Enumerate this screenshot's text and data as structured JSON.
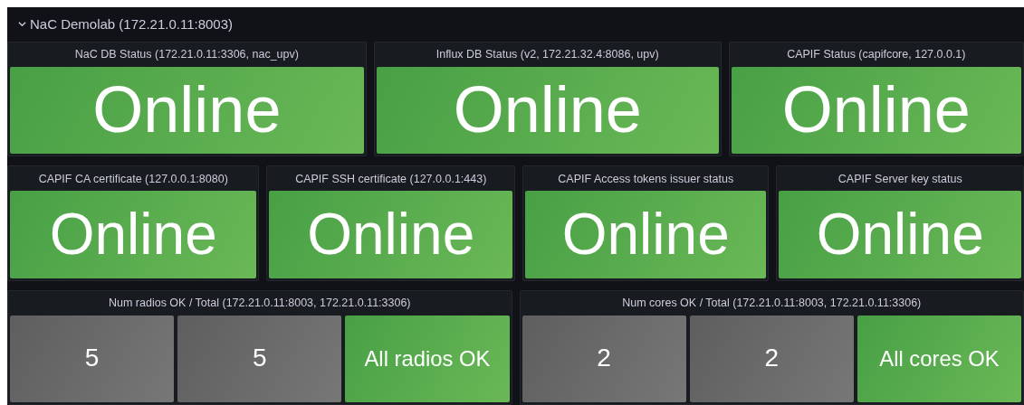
{
  "row": {
    "title": "NaC Demolab (172.21.0.11:8003)",
    "expanded": true
  },
  "panel_rows": [
    {
      "panels": [
        {
          "title": "NaC DB Status (172.21.0.11:3306, nac_upv)",
          "tiles": [
            {
              "value": "Online",
              "kind": "ok"
            }
          ]
        },
        {
          "title": "Influx DB Status (v2, 172.21.32.4:8086, upv)",
          "tiles": [
            {
              "value": "Online",
              "kind": "ok"
            }
          ]
        },
        {
          "title": "CAPIF Status (capifcore, 127.0.0.1)",
          "tiles": [
            {
              "value": "Online",
              "kind": "ok"
            }
          ]
        }
      ]
    },
    {
      "panels": [
        {
          "title": "CAPIF CA certificate (127.0.0.1:8080)",
          "tiles": [
            {
              "value": "Online",
              "kind": "ok"
            }
          ]
        },
        {
          "title": "CAPIF SSH certificate (127.0.0.1:443)",
          "tiles": [
            {
              "value": "Online",
              "kind": "ok"
            }
          ]
        },
        {
          "title": "CAPIF Access tokens issuer status",
          "tiles": [
            {
              "value": "Online",
              "kind": "ok"
            }
          ]
        },
        {
          "title": "CAPIF Server key status",
          "tiles": [
            {
              "value": "Online",
              "kind": "ok"
            }
          ]
        }
      ]
    },
    {
      "panels": [
        {
          "title": "Num radios OK / Total (172.21.0.11:8003, 172.21.0.11:3306)",
          "tiles": [
            {
              "value": "5",
              "kind": "neutral"
            },
            {
              "value": "5",
              "kind": "neutral"
            },
            {
              "value": "All radios OK",
              "kind": "ok"
            }
          ]
        },
        {
          "title": "Num cores OK / Total (172.21.0.11:8003, 172.21.0.11:3306)",
          "tiles": [
            {
              "value": "2",
              "kind": "neutral"
            },
            {
              "value": "2",
              "kind": "neutral"
            },
            {
              "value": "All cores OK",
              "kind": "ok"
            }
          ]
        }
      ]
    }
  ]
}
